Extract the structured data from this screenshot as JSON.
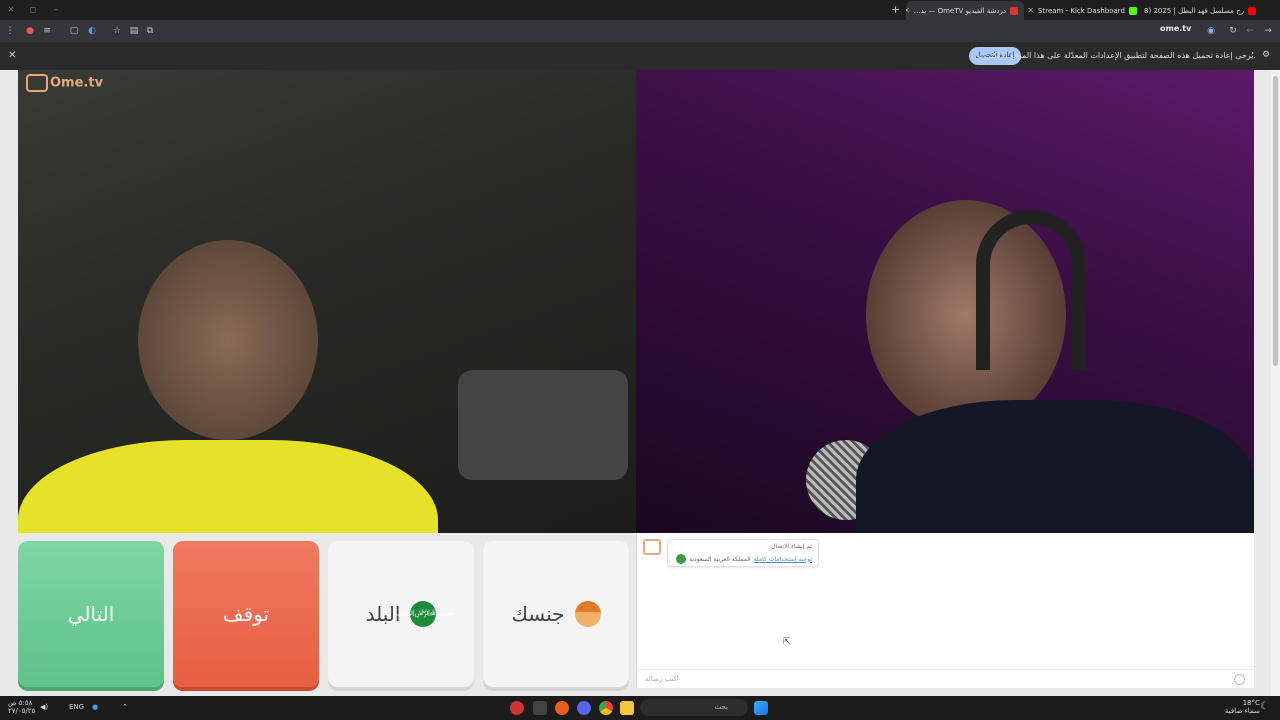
{
  "browser": {
    "tabs": [
      {
        "label": "Stream - Kick Dashboard",
        "favicon_color": "#53fc18",
        "active": false
      },
      {
        "label": "دردشة الفيديو OmeTV — بد...",
        "favicon_color": "#d33",
        "active": true
      },
      {
        "label": "رج مسلسل فهد البطل | 2025 (8)",
        "favicon_color": "#f00",
        "active": false
      }
    ],
    "new_tab": "+",
    "url": "ome.tv",
    "info_message": "يُرجى إعادة تحميل هذه الصفحة لتطبيق الإعدادات المعدّلة على هذا الموقع الإلكتروني.",
    "reload_label": "إعادة التحميل"
  },
  "site": {
    "logo": "Ome.tv",
    "controls": {
      "next": "التالي",
      "stop": "توقف",
      "country": "البلد",
      "gender": "جنسك"
    },
    "chat": {
      "notice_line1": "تم إنشاء الاتصال",
      "notice_link": "توجيه استخدامات كاملة",
      "notice_country": "المملكة العربية السعودية",
      "input_placeholder": "اكتب رسالة"
    }
  },
  "taskbar": {
    "search_placeholder": "بحث",
    "lang": "ENG",
    "weather_temp": "18°C",
    "weather_desc": "سماء صافية",
    "time": "٥:٥٨ ص",
    "date": "٢٧/٠٥/٢٥"
  },
  "colors": {
    "next": "#6ccc95",
    "stop": "#ec6b4f"
  }
}
